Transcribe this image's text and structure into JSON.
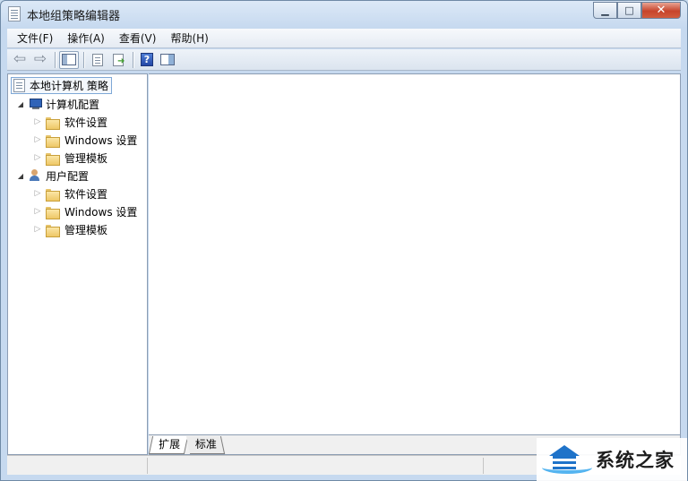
{
  "window": {
    "title": "本地组策略编辑器",
    "controls": {
      "minimize": "▁",
      "maximize": "□",
      "close": "✕"
    }
  },
  "menu": [
    "文件(F)",
    "操作(A)",
    "查看(V)",
    "帮助(H)"
  ],
  "toolbar": {
    "buttons": [
      "back-arrow-icon",
      "forward-arrow-icon",
      "show-hide-tree-icon",
      "properties-icon",
      "export-list-icon",
      "help-icon",
      "action-pane-icon"
    ],
    "help_glyph": "?"
  },
  "tree": {
    "root": "本地计算机 策略",
    "computer": {
      "label": "计算机配置",
      "expander": "◢",
      "children": [
        "软件设置",
        "Windows 设置",
        "管理模板"
      ]
    },
    "user": {
      "label": "用户配置",
      "expander": "◢",
      "children": [
        "软件设置",
        "Windows 设置",
        "管理模板"
      ]
    },
    "collapsed_glyph": "▷"
  },
  "tabs": [
    "扩展",
    "标准"
  ],
  "watermark": {
    "text": "系统之家"
  },
  "colors": {
    "frame": "#c6d9ef",
    "close_button": "#c7442b",
    "selection_border": "#7fa8d6",
    "folder": "#eec766"
  }
}
